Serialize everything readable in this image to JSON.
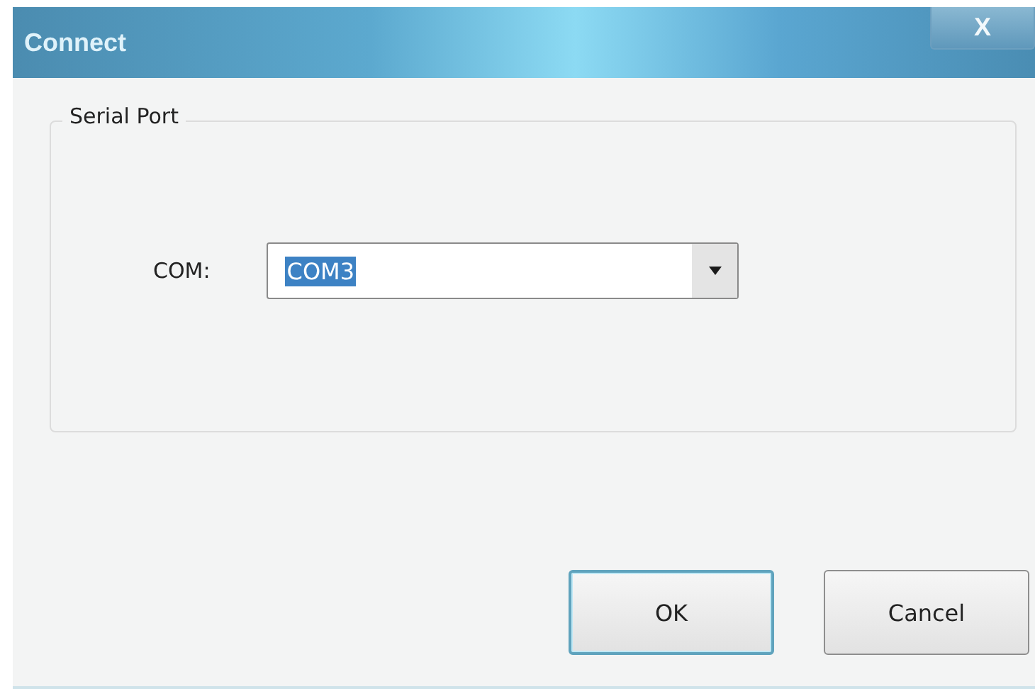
{
  "window": {
    "title": "Connect",
    "close": "X"
  },
  "group": {
    "legend": "Serial Port",
    "label": "COM:",
    "combo": {
      "value": "COM3",
      "highlighted": true
    }
  },
  "buttons": [
    {
      "label": "OK",
      "default": true
    },
    {
      "label": "Cancel",
      "default": false
    }
  ]
}
